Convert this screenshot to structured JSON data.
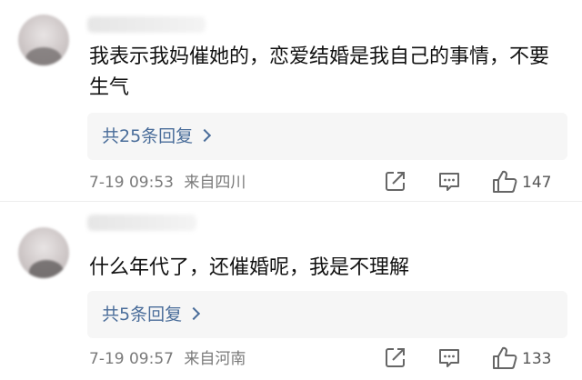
{
  "comments": [
    {
      "text": "我表示我妈催她的，恋爱结婚是我自己的事情，不要生气",
      "replies_label": "共25条回复",
      "timestamp": "7-19 09:53",
      "location": "来自四川",
      "like_count": "147"
    },
    {
      "text": "什么年代了，还催婚呢，我是不理解",
      "replies_label": "共5条回复",
      "timestamp": "7-19 09:57",
      "location": "来自河南",
      "like_count": "133"
    }
  ],
  "icons": {
    "share": "share-icon",
    "comment": "comment-icon",
    "like": "thumbs-up-icon",
    "chevron": "chevron-right-icon"
  },
  "colors": {
    "link": "#4a6d9a",
    "meta": "#7a7a7a",
    "reply_bg": "#f6f6f6"
  }
}
